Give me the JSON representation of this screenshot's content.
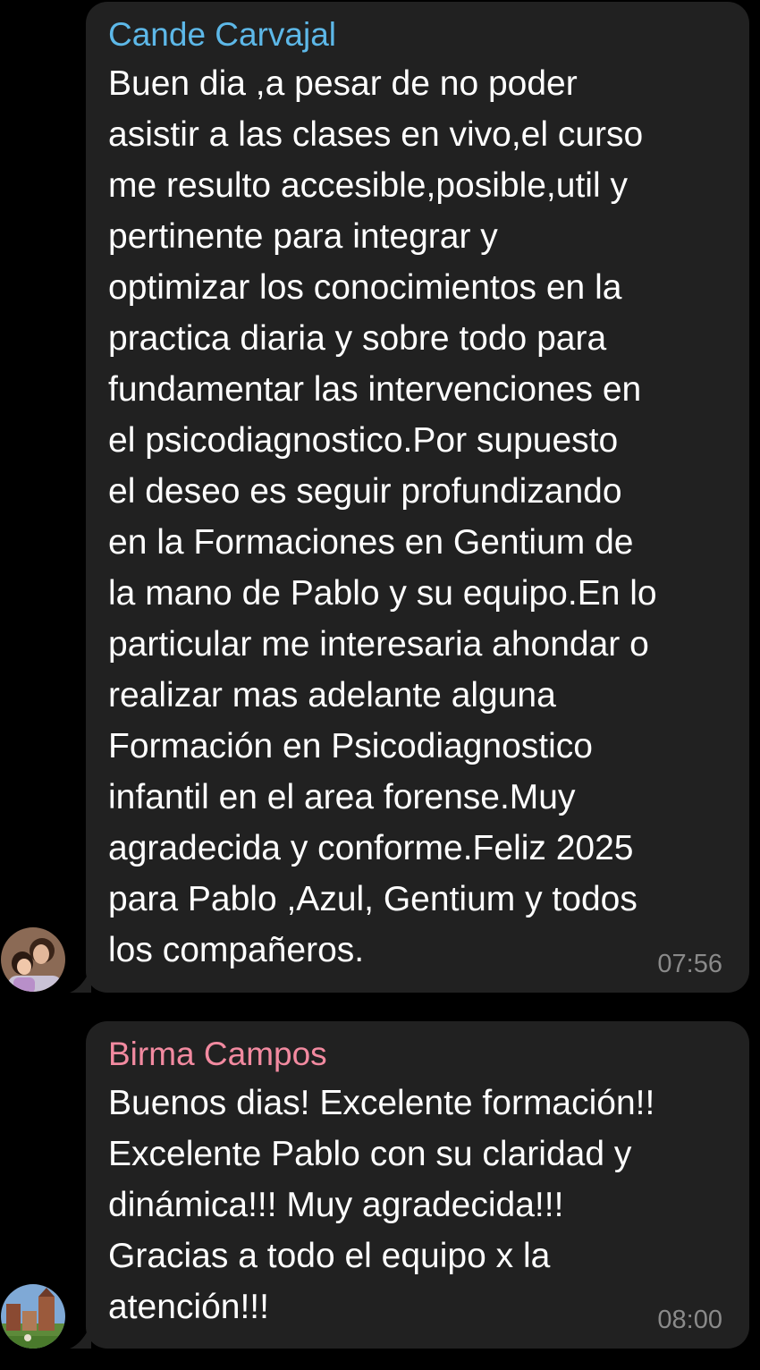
{
  "colors": {
    "background": "#000000",
    "bubble": "#212121",
    "time": "#8a8a8a"
  },
  "messages": [
    {
      "sender": "Cande Carvajal",
      "sender_color": "#5db8e8",
      "text": "Buen dia ,a pesar de no poder\nasistir a las clases en vivo,el curso\nme resulto accesible,posible,util y\npertinente para integrar y\noptimizar los conocimientos en la\npractica diaria y sobre todo para\nfundamentar las intervenciones en\nel psicodiagnostico.Por supuesto\nel deseo es seguir profundizando\nen la Formaciones en Gentium de\nla mano de Pablo y su equipo.En lo\nparticular me interesaria ahondar o\nrealizar  mas adelante alguna\nFormación en Psicodiagnostico\ninfantil en el area forense.Muy\nagradecida y conforme.Feliz 2025\npara Pablo ,Azul, Gentium y todos\nlos compañeros.",
      "time": "07:56",
      "avatar_icon": "avatar-photo-icon"
    },
    {
      "sender": "Birma Campos",
      "sender_color": "#f28aa0",
      "text": "Buenos dias! Excelente formación!!\nExcelente Pablo con su claridad y\ndinámica!!! Muy agradecida!!!\nGracias a todo el equipo x la\natención!!!",
      "time": "08:00",
      "avatar_icon": "avatar-photo-icon"
    }
  ]
}
